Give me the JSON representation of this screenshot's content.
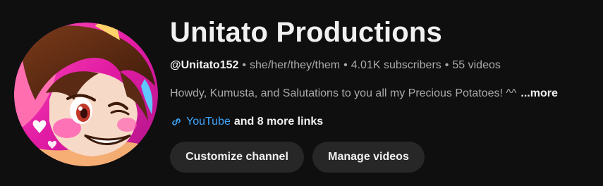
{
  "channel": {
    "name": "Unitato Productions",
    "handle": "@Unitato152",
    "pronouns": "she/her/they/them",
    "subscribers": "4.01K subscribers",
    "videos": "55 videos",
    "separator": "•"
  },
  "description": {
    "text": "Howdy, Kumusta, and Salutations to you all my Precious Potatoes! ^^",
    "more_label": "...more"
  },
  "links": {
    "icon": "link-icon",
    "primary": "YouTube",
    "more": "and 8 more links"
  },
  "buttons": {
    "customize": "Customize channel",
    "manage": "Manage videos"
  },
  "avatar": {
    "icon": "channel-avatar",
    "ring_color": "#e11ca4",
    "hair_color": "#5b2a14",
    "skin_color": "#f7d9c8",
    "cheek_color": "#ff4fb0"
  },
  "colors": {
    "background": "#0f0f0f",
    "text_primary": "#f1f1f1",
    "text_secondary": "#aaaaaa",
    "link": "#3ea6ff",
    "button_bg": "#272727"
  }
}
